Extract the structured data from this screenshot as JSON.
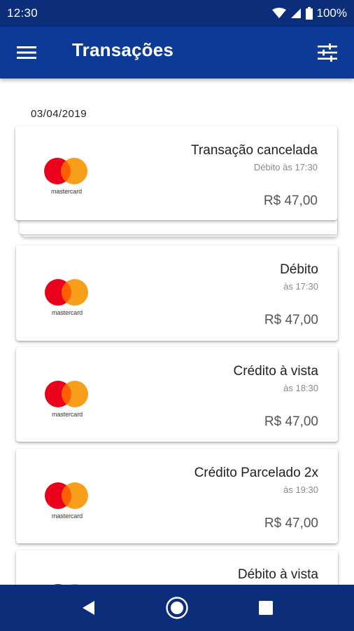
{
  "status_bar": {
    "time": "12:30",
    "battery": "100%"
  },
  "app_bar": {
    "title": "Transações",
    "menu_icon": "hamburger-menu-icon",
    "filter_icon": "sliders-filter-icon"
  },
  "date_group": "03/04/2019",
  "brand_label": "mastercard",
  "transactions": [
    {
      "title": "Transação cancelada",
      "subtitle": "Débito às 17:30",
      "amount": "R$ 47,00"
    },
    {
      "title": "Débito",
      "subtitle": "às 17:30",
      "amount": "R$ 47,00"
    },
    {
      "title": "Crédito à vista",
      "subtitle": "às 18:30",
      "amount": "R$ 47,00"
    },
    {
      "title": "Crédito Parcelado 2x",
      "subtitle": "às 19:30",
      "amount": "R$ 47,00"
    },
    {
      "title": "Débito à vista"
    }
  ],
  "colors": {
    "status_bar": "#0b2d7a",
    "app_bar": "#0d3a96",
    "mc_red": "#eb001b",
    "mc_orange": "#f79e1b",
    "mc_overlap": "#ff5f00"
  },
  "nav_bar": {
    "back_icon": "back-triangle-icon",
    "home_icon": "home-circle-icon",
    "recents_icon": "recents-square-icon"
  }
}
